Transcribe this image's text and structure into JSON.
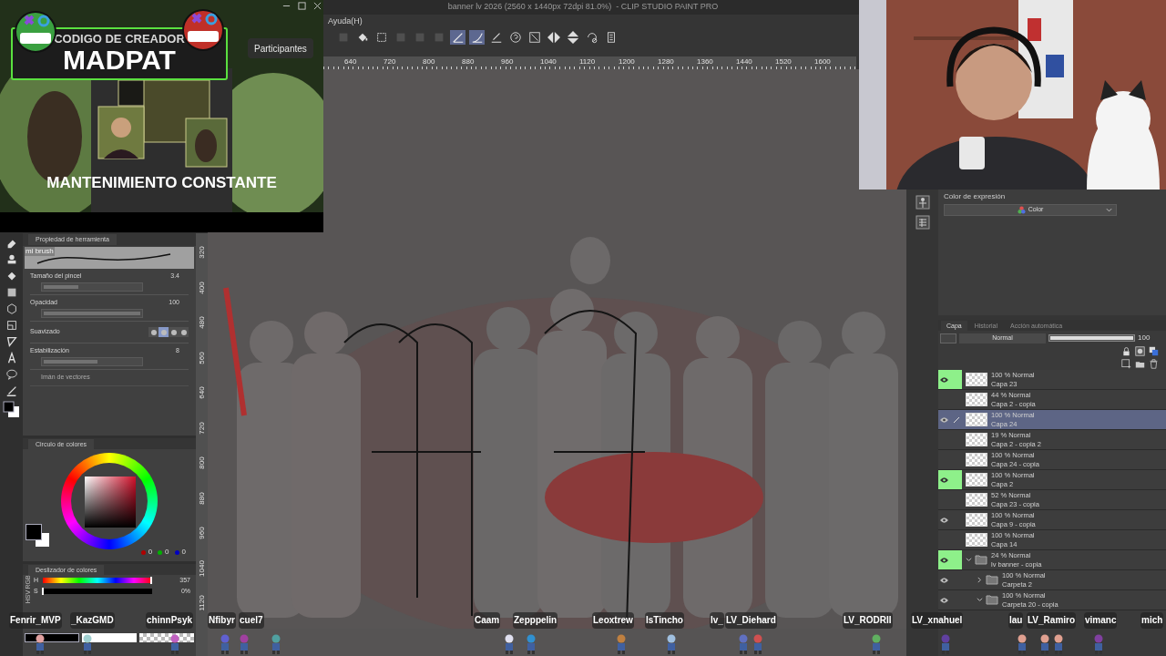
{
  "window": {
    "title": "banner lv 2026 (2560 x 1440px 72dpi 81.0%)  - CLIP STUDIO PAINT PRO"
  },
  "menu": [
    "Ayuda(H)"
  ],
  "toolbar": [
    {
      "kind": "square",
      "selected": false,
      "disabled": true
    },
    {
      "kind": "bucket",
      "selected": false,
      "disabled": false
    },
    {
      "kind": "frame",
      "selected": false,
      "disabled": false
    },
    {
      "kind": "square",
      "selected": false,
      "disabled": true
    },
    {
      "kind": "square",
      "selected": false,
      "disabled": true
    },
    {
      "kind": "square",
      "selected": false,
      "disabled": true
    },
    {
      "kind": "snap-line",
      "selected": true,
      "disabled": false
    },
    {
      "kind": "snap-curve",
      "selected": true,
      "disabled": false
    },
    {
      "kind": "pen-line",
      "selected": false,
      "disabled": false
    },
    {
      "kind": "help",
      "selected": false,
      "disabled": false
    },
    {
      "kind": "resize",
      "selected": false,
      "disabled": false
    },
    {
      "kind": "flip-h",
      "selected": false,
      "disabled": false
    },
    {
      "kind": "flip-v",
      "selected": false,
      "disabled": false
    },
    {
      "kind": "rotate",
      "selected": false,
      "disabled": false
    },
    {
      "kind": "page",
      "selected": false,
      "disabled": false
    }
  ],
  "ruler": {
    "horizontal": [
      "640",
      "720",
      "800",
      "880",
      "960",
      "1040",
      "1120",
      "1200",
      "1280",
      "1360",
      "1440",
      "1520",
      "1600"
    ],
    "vertical": [
      "320",
      "400",
      "480",
      "560",
      "640",
      "720",
      "800",
      "880",
      "960",
      "1040",
      "1120"
    ]
  },
  "stream_video": {
    "banner_top": "CODIGO DE CREADOR",
    "banner_name": "MADPAT",
    "button": "Participantes",
    "caption": "MANTENIMIENTO CONSTANTE"
  },
  "tool_property": {
    "tab": "Propiedad de herramienta",
    "brush": "mi brush",
    "settings": [
      {
        "kind": "slider",
        "label": "Tamaño del pincel",
        "value": "3.4",
        "level": 0.36
      },
      {
        "kind": "slider",
        "label": "Opacidad",
        "value": "100",
        "level": 1
      },
      {
        "kind": "options",
        "label": "Suavizado",
        "options": [
          {
            "selected": false
          },
          {
            "selected": true
          },
          {
            "selected": false
          },
          {
            "selected": false
          }
        ]
      },
      {
        "kind": "slider",
        "label": "Estabilización",
        "value": "8",
        "level": 0.56
      },
      {
        "kind": "toggle",
        "label": "Imán de vectores",
        "disabled": true
      }
    ]
  },
  "color_wheel": {
    "tab": "Circulo de colores",
    "rgb": [
      "0",
      "0",
      "0"
    ]
  },
  "color_slider": {
    "tab": "Deslizador de colores",
    "modes": [
      "RGB",
      "HSV"
    ],
    "rows": [
      {
        "label": "H",
        "value": "357",
        "level": 0.99
      },
      {
        "label": "S",
        "value": "0%",
        "level": 0
      }
    ]
  },
  "expression_color": {
    "label": "Color de expresión",
    "value": "Color"
  },
  "layer_panel": {
    "tabs": [
      {
        "label": "Capa",
        "selected": true
      },
      {
        "label": "Historial",
        "selected": false
      },
      {
        "label": "Acción automática",
        "selected": false
      }
    ],
    "blend": "Normal",
    "opacity": "100",
    "opacity_slider": {
      "level": 1
    },
    "layers": [
      {
        "kind": "layer",
        "mode": "100 % Normal",
        "name": "Capa 23",
        "visible": true,
        "flagged": true,
        "selected": false
      },
      {
        "kind": "layer",
        "mode": "44 % Normal",
        "name": "Capa 2 - copia",
        "visible": false,
        "flagged": false,
        "selected": false
      },
      {
        "kind": "layer",
        "mode": "100 % Normal",
        "name": "Capa 24",
        "visible": true,
        "flagged": false,
        "selected": true
      },
      {
        "kind": "layer",
        "mode": "19 % Normal",
        "name": "Capa 2 - copia 2",
        "visible": false,
        "flagged": false,
        "selected": false
      },
      {
        "kind": "layer",
        "mode": "100 % Normal",
        "name": "Capa 24 - copia",
        "visible": false,
        "flagged": false,
        "selected": false
      },
      {
        "kind": "layer",
        "mode": "100 % Normal",
        "name": "Capa 2",
        "visible": true,
        "flagged": true,
        "selected": false
      },
      {
        "kind": "layer",
        "mode": "52 % Normal",
        "name": "Capa 23 - copia",
        "visible": false,
        "flagged": false,
        "selected": false
      },
      {
        "kind": "layer",
        "mode": "100 % Normal",
        "name": "Capa 9 - copia",
        "visible": true,
        "flagged": false,
        "selected": false
      },
      {
        "kind": "layer",
        "mode": "100 % Normal",
        "name": "Capa 14",
        "visible": false,
        "flagged": false,
        "selected": false
      },
      {
        "kind": "folder",
        "mode": "24 % Normal",
        "name": "lv banner - copia",
        "visible": true,
        "flagged": true,
        "selected": false,
        "expanded": true,
        "children": [
          {
            "kind": "folder",
            "mode": "100 % Normal",
            "name": "Carpeta 2",
            "visible": true,
            "flagged": false,
            "selected": false,
            "expanded": false
          },
          {
            "kind": "folder",
            "mode": "100 % Normal",
            "name": "Carpeta 20 - copia",
            "visible": true,
            "flagged": false,
            "selected": false,
            "expanded": true
          }
        ]
      }
    ]
  },
  "chat_names": [
    "Fenrir_MVP",
    "_KazGMD",
    "chinnPsyk",
    "Nfibyr",
    "cuel7",
    "Caam",
    "Zepppelin",
    "Leoxtrew",
    "IsTincho",
    "lv_",
    "LV_Diehard",
    "LV_RODRII",
    "LV_xnahuel",
    "lau",
    "LV_Ramiro",
    "vimanc",
    "mich"
  ]
}
